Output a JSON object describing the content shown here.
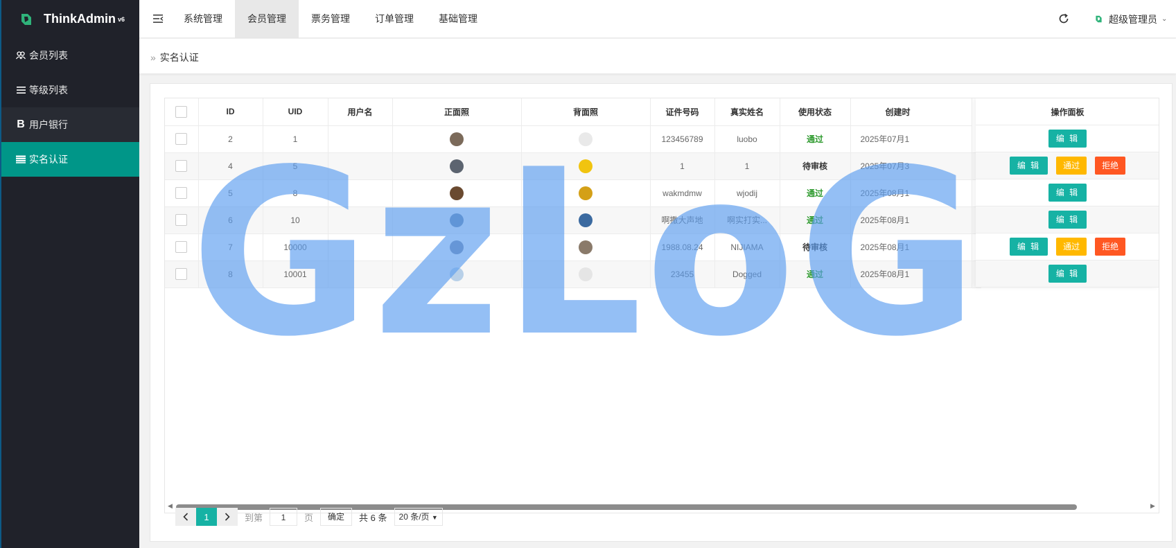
{
  "app": {
    "name": "ThinkAdmin",
    "version": "v6"
  },
  "sidebar": {
    "items": [
      {
        "icon": "users-icon",
        "label": "会员列表"
      },
      {
        "icon": "list-icon",
        "label": "等级列表"
      },
      {
        "icon": "bold-b-icon",
        "label": "用户银行"
      },
      {
        "icon": "table-icon",
        "label": "实名认证"
      }
    ]
  },
  "header": {
    "nav": [
      "系统管理",
      "会员管理",
      "票务管理",
      "订单管理",
      "基础管理"
    ],
    "active_nav": "会员管理",
    "user": "超级管理员"
  },
  "breadcrumb": {
    "current": "实名认证"
  },
  "table": {
    "columns": [
      "ID",
      "UID",
      "用户名",
      "正面照",
      "背面照",
      "证件号码",
      "真实姓名",
      "使用状态",
      "创建时",
      "操作面板"
    ],
    "rows": [
      {
        "id": "2",
        "uid": "1",
        "username": "",
        "id_no": "123456789",
        "real_name": "luobo",
        "status": "通过",
        "created": "2025年07月1",
        "actions": [
          "编 辑"
        ]
      },
      {
        "id": "4",
        "uid": "5",
        "username": "",
        "id_no": "1",
        "real_name": "1",
        "status": "待审核",
        "created": "2025年07月3",
        "actions": [
          "编 辑",
          "通过",
          "拒绝"
        ]
      },
      {
        "id": "5",
        "uid": "8",
        "username": "",
        "id_no": "wakmdmw",
        "real_name": "wjodij",
        "status": "通过",
        "created": "2025年08月1",
        "actions": [
          "编 辑"
        ]
      },
      {
        "id": "6",
        "uid": "10",
        "username": "",
        "id_no": "啊撒大声地",
        "real_name": "啊实打实...",
        "status": "通过",
        "created": "2025年08月1",
        "actions": [
          "编 辑"
        ]
      },
      {
        "id": "7",
        "uid": "10000",
        "username": "",
        "id_no": "1988.08.24",
        "real_name": "NIJIAMA",
        "status": "待审核",
        "created": "2025年08月1",
        "actions": [
          "编 辑",
          "通过",
          "拒绝"
        ]
      },
      {
        "id": "8",
        "uid": "10001",
        "username": "",
        "id_no": "23455",
        "real_name": "Dogged",
        "status": "通过",
        "created": "2025年08月1",
        "actions": [
          "编 辑"
        ]
      }
    ]
  },
  "pager": {
    "current_page": "1",
    "goto_label": "到第",
    "goto_value": "1",
    "page_unit": "页",
    "confirm": "确定",
    "total": "共 6 条",
    "page_size": "20 条/页"
  },
  "watermark": {
    "text": "GzLoG",
    "color": "#5b9cf0"
  },
  "colors": {
    "accent": "#009688",
    "edit": "#16b2a4",
    "pass": "#ffb800",
    "reject": "#ff5722",
    "sidebar": "#20222a"
  }
}
